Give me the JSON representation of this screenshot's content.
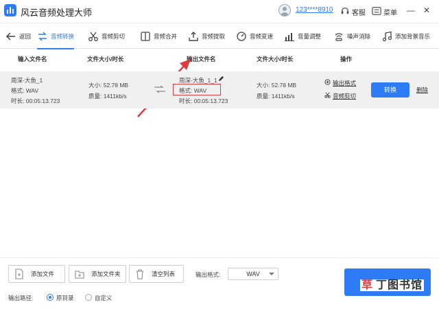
{
  "app": {
    "title": "风云音频处理大师",
    "account": "123****8910",
    "service_label": "客服",
    "menu_label": "菜单"
  },
  "toolbar": {
    "back": "返回",
    "items": [
      {
        "label": "音频转换",
        "icon": "convert-icon",
        "active": true
      },
      {
        "label": "音频剪切",
        "icon": "scissors-icon"
      },
      {
        "label": "音频合并",
        "icon": "merge-icon"
      },
      {
        "label": "音频提取",
        "icon": "extract-icon"
      },
      {
        "label": "音频变速",
        "icon": "speed-icon"
      },
      {
        "label": "音量调整",
        "icon": "volume-icon"
      },
      {
        "label": "噪声消除",
        "icon": "noise-icon"
      },
      {
        "label": "添加背景音乐",
        "icon": "music-icon"
      }
    ]
  },
  "table": {
    "headers": [
      "输入文件名",
      "文件大小/时长",
      "输出文件名",
      "文件大小/时长",
      "操作"
    ],
    "row": {
      "input_name": "周深-大鱼_1",
      "input_format": "格式:  WAV",
      "input_duration": "时长:  00:05:13.723",
      "input_size": "大小:  52.78 MB",
      "input_quality": "质量:  1411kb/s",
      "output_name": "周深-大鱼_1_1",
      "output_format": "格式:  WAV",
      "output_duration": "时长:  00:05:13.723",
      "output_size": "大小:  52.78 MB",
      "output_quality": "质量:  1411kb/s",
      "action_format": "输出格式",
      "action_cut": "音频剪切",
      "convert": "转换",
      "delete": "删除"
    }
  },
  "bottom": {
    "add_file": "添加文件",
    "add_folder": "添加文件夹",
    "clear_list": "清空列表",
    "output_format_label": "输出格式:",
    "output_format_value": "WAV",
    "output_path_label": "输出路径:",
    "path_original": "原目录",
    "path_custom": "自定义",
    "path_selected": "原目录"
  },
  "watermark": {
    "text_a": "草",
    "text_b": "丁图书馆"
  },
  "colors": {
    "accent": "#2d7cf6",
    "highlight": "#e03a3a",
    "row_bg": "#f0f0f0"
  }
}
